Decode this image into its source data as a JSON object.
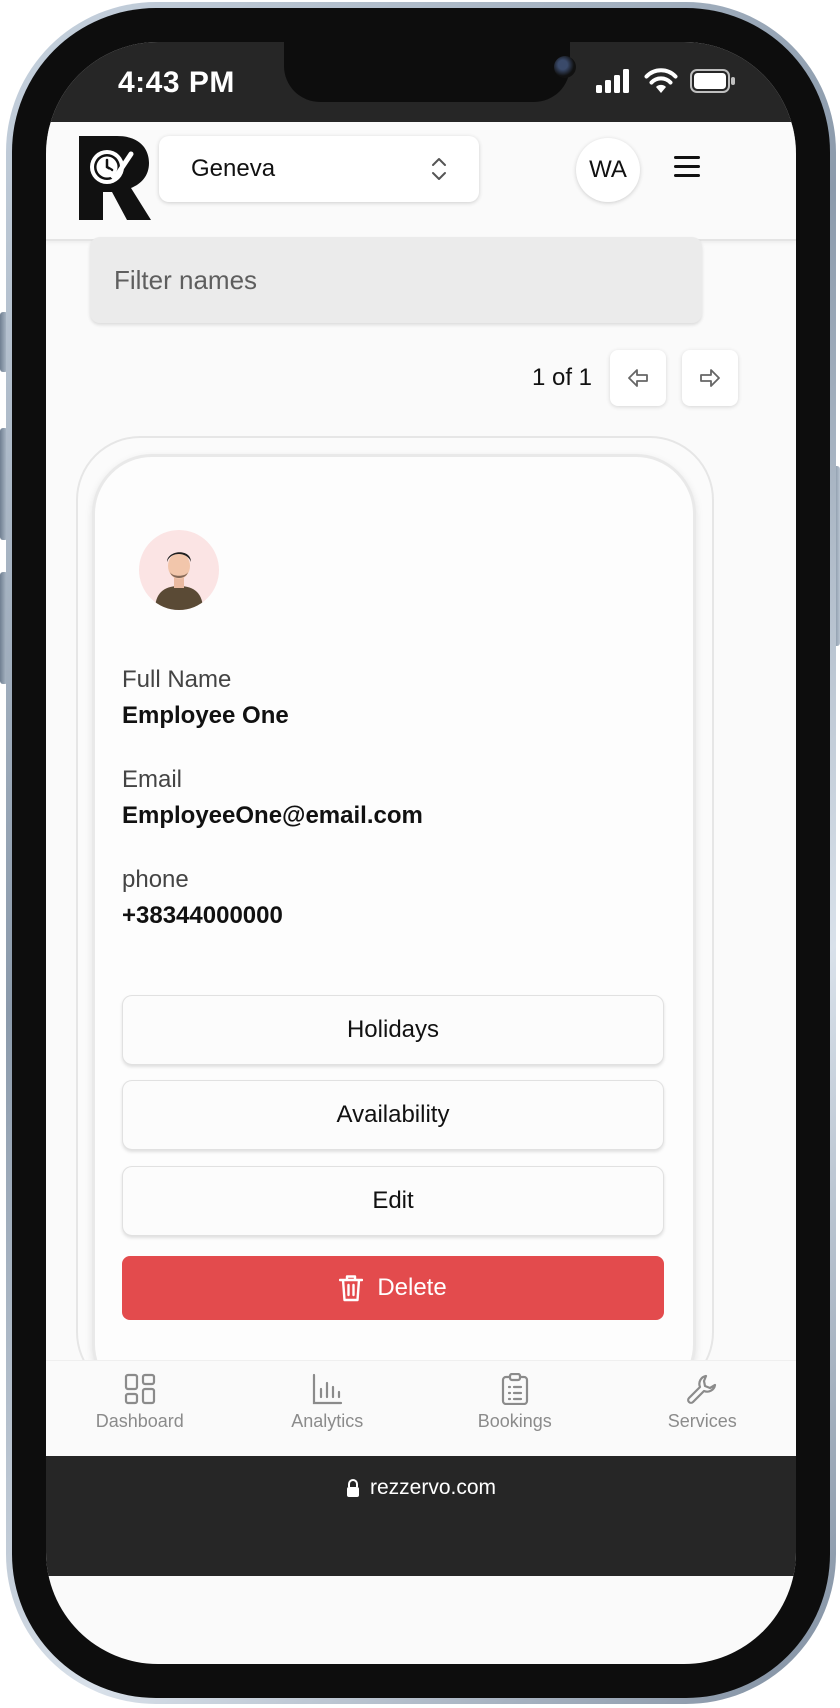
{
  "status_bar": {
    "time": "4:43 PM"
  },
  "header": {
    "location": "Geneva",
    "user_initials": "WA"
  },
  "filter": {
    "placeholder": "Filter names"
  },
  "pagination": {
    "text": "1 of 1"
  },
  "employee": {
    "full_name_label": "Full Name",
    "full_name": "Employee One",
    "email_label": "Email",
    "email": "EmployeeOne@email.com",
    "phone_label": "phone",
    "phone": "+38344000000"
  },
  "actions": {
    "holidays": "Holidays",
    "availability": "Availability",
    "edit": "Edit",
    "delete": "Delete"
  },
  "bottom_nav": [
    {
      "label": "Dashboard",
      "icon": "dashboard-icon"
    },
    {
      "label": "Analytics",
      "icon": "analytics-icon"
    },
    {
      "label": "Bookings",
      "icon": "clipboard-icon"
    },
    {
      "label": "Services",
      "icon": "wrench-icon"
    }
  ],
  "browser": {
    "url": "rezzervo.com"
  },
  "colors": {
    "delete": "#e34b4d",
    "nav_inactive": "#8b8b8b",
    "frame": "#0d0d0d"
  }
}
